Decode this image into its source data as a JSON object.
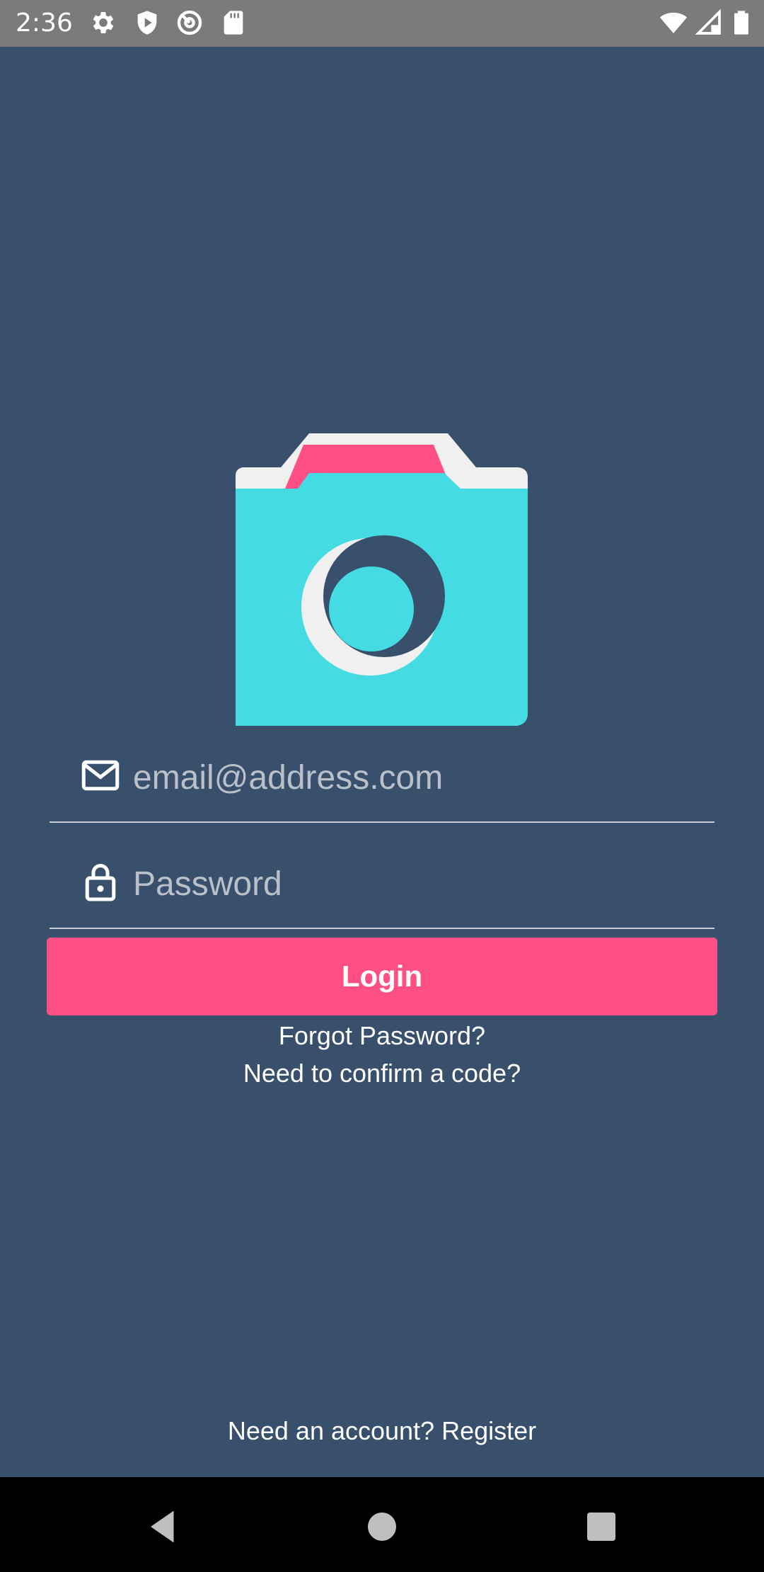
{
  "status_bar": {
    "time": "2:36",
    "icons": [
      "settings-icon",
      "shield-play-icon",
      "at-sign-icon",
      "sd-card-icon",
      "wifi-icon",
      "signal-icon",
      "battery-icon"
    ]
  },
  "logo": {
    "icon": "camera-logo-icon",
    "colors": {
      "body": "#44dce2",
      "accent": "#ff5086",
      "highlight": "#f1f0f1",
      "dark": "#38506b"
    }
  },
  "form": {
    "email": {
      "placeholder": "email@address.com",
      "value": "",
      "icon": "mail-icon"
    },
    "password": {
      "placeholder": "Password",
      "value": "",
      "icon": "lock-icon"
    },
    "login_label": "Login"
  },
  "links": {
    "forgot": "Forgot Password?",
    "confirm": "Need to confirm a code?",
    "register": "Need an account? Register"
  },
  "colors": {
    "background": "#38506b",
    "button": "#ff5086",
    "status_bar": "#7b7b7b"
  },
  "nav_bar": {
    "icons": [
      "back-icon",
      "home-icon",
      "recents-icon"
    ]
  }
}
